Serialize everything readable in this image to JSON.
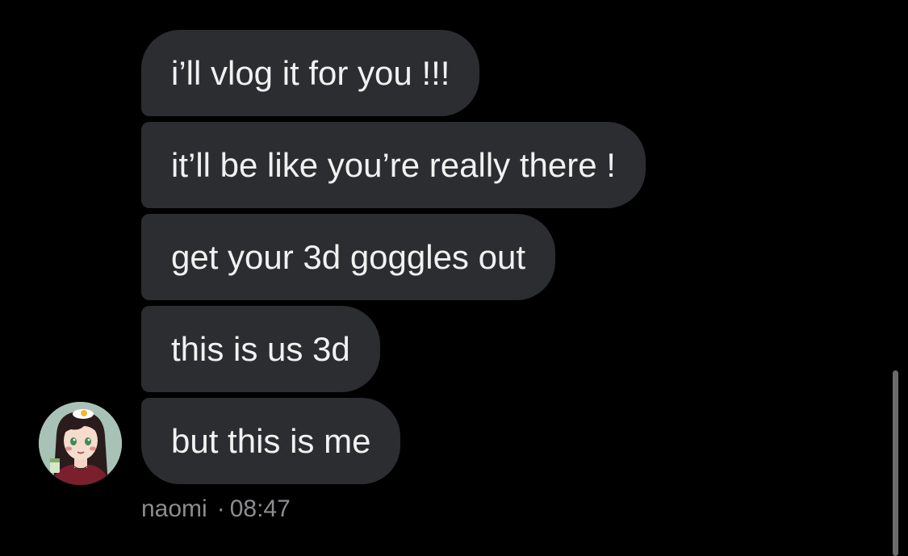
{
  "conversation": {
    "messages": [
      {
        "text": "i’ll vlog it for you !!!"
      },
      {
        "text": "it’ll be like you’re really there !"
      },
      {
        "text": "get your 3d goggles out"
      },
      {
        "text": "this is us 3d"
      },
      {
        "text": "but this is me"
      }
    ],
    "sender": {
      "name": "naomi",
      "separator": "·",
      "time": "08:47",
      "avatar_icon": "illustrated-girl-avatar"
    }
  },
  "colors": {
    "background": "#000000",
    "bubble": "#2c2d30",
    "message_text": "#f1f1f1",
    "meta_text": "#8c8d90",
    "avatar_background": "#a9c2b8"
  }
}
